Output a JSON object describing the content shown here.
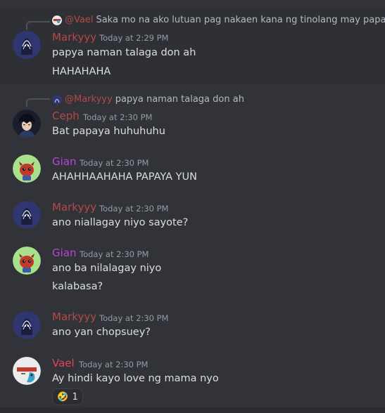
{
  "colors": {
    "background": "#313338",
    "vael": "#e0435e",
    "markyyy": "#b24a48",
    "ceph": "#b24a48",
    "gian": "#b845d6",
    "timestamp": "#949ba4",
    "text": "#dbdee1"
  },
  "messages": [
    {
      "reply": {
        "mention": "@Vael",
        "text": "Saka mo na ako lutuan pag nakaen kana ng tinolang may papaya"
      },
      "author": "Markyyy",
      "time": "Today at 2:29 PM",
      "lines": [
        "papya naman talaga don ah",
        "HAHAHAHA"
      ]
    },
    {
      "reply": {
        "mention": "@Markyyy",
        "text": "papya naman talaga don ah"
      },
      "author": "Ceph",
      "time": "Today at 2:30 PM",
      "lines": [
        "Bat papaya huhuhuhu"
      ]
    },
    {
      "author": "Gian",
      "time": "Today at 2:30 PM",
      "lines": [
        "AHAHHAAHAHA PAPAYA YUN"
      ]
    },
    {
      "author": "Markyyy",
      "time": "Today at 2:30 PM",
      "lines": [
        "ano niallagay niyo sayote?"
      ]
    },
    {
      "author": "Gian",
      "time": "Today at 2:30 PM",
      "lines": [
        "ano ba nilalagay niyo",
        "kalabasa?"
      ]
    },
    {
      "author": "Markyyy",
      "time": "Today at 2:30 PM",
      "lines": [
        "ano yan chopsuey?"
      ]
    },
    {
      "author": "Vael",
      "time": "Today at 2:30 PM",
      "lines": [
        "Ay hindi kayo love ng mama nyo"
      ],
      "reaction": {
        "emoji": "🤣",
        "emoji_name": "rofl-emoji",
        "count": "1"
      }
    }
  ]
}
